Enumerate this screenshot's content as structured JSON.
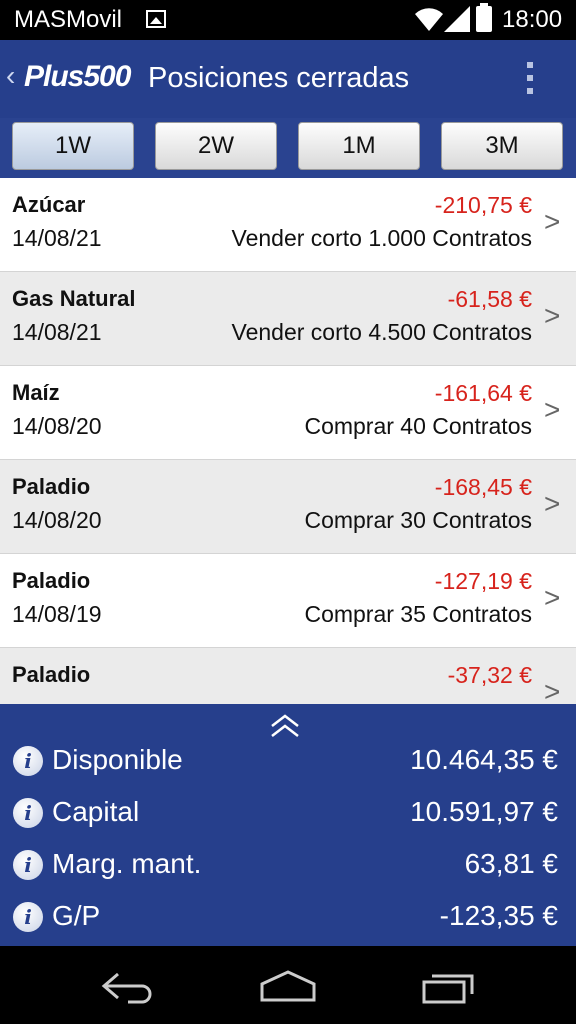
{
  "status_bar": {
    "carrier": "MASMovil",
    "time": "18:00"
  },
  "app_bar": {
    "logo": "Plus500",
    "title": "Posiciones cerradas"
  },
  "tabs": [
    {
      "label": "1W",
      "active": true
    },
    {
      "label": "2W",
      "active": false
    },
    {
      "label": "1M",
      "active": false
    },
    {
      "label": "3M",
      "active": false
    }
  ],
  "positions": [
    {
      "instrument": "Azúcar",
      "date": "14/08/21",
      "pnl": "-210,75 €",
      "detail": "Vender corto 1.000 Contratos"
    },
    {
      "instrument": "Gas Natural",
      "date": "14/08/21",
      "pnl": "-61,58 €",
      "detail": "Vender corto 4.500 Contratos"
    },
    {
      "instrument": "Maíz",
      "date": "14/08/20",
      "pnl": "-161,64 €",
      "detail": "Comprar 40 Contratos"
    },
    {
      "instrument": "Paladio",
      "date": "14/08/20",
      "pnl": "-168,45 €",
      "detail": "Comprar 30 Contratos"
    },
    {
      "instrument": "Paladio",
      "date": "14/08/19",
      "pnl": "-127,19 €",
      "detail": "Comprar 35 Contratos"
    },
    {
      "instrument": "Paladio",
      "date": "",
      "pnl": "-37,32 €",
      "detail": ""
    }
  ],
  "summary": [
    {
      "label": "Disponible",
      "value": "10.464,35 €"
    },
    {
      "label": "Capital",
      "value": "10.591,97 €"
    },
    {
      "label": "Marg. mant.",
      "value": "63,81 €"
    },
    {
      "label": "G/P",
      "value": "-123,35 €"
    }
  ],
  "colors": {
    "app_bar": "#263f8c",
    "negative": "#d7231c",
    "row_alt": "#ebebeb"
  },
  "icons": {
    "status": [
      "image-icon",
      "wifi-icon",
      "signal-icon",
      "battery-icon"
    ],
    "nav": [
      "back-icon",
      "home-icon",
      "recent-apps-icon"
    ]
  }
}
